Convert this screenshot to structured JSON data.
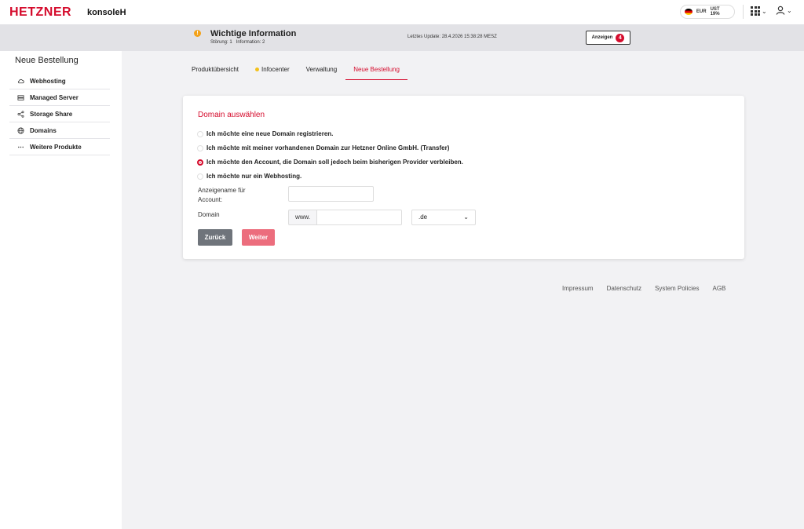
{
  "header": {
    "logo": "HETZNER",
    "product": "konsoleH",
    "currency": "EUR",
    "vat": "UST 19%"
  },
  "infobar": {
    "title": "Wichtige Information",
    "disruptions": "Störung: 1",
    "information": "Information: 2",
    "last_update": "Letztes Update: 28.4.2026 15:38:28 MESZ",
    "show_label": "Anzeigen",
    "badge_count": "4"
  },
  "sidebar": {
    "title": "Neue Bestellung",
    "items": [
      {
        "label": "Webhosting",
        "icon": "cloud-icon"
      },
      {
        "label": "Managed Server",
        "icon": "server-icon"
      },
      {
        "label": "Storage Share",
        "icon": "share-icon"
      },
      {
        "label": "Domains",
        "icon": "globe-icon"
      },
      {
        "label": "Weitere Produkte",
        "icon": "more-icon"
      }
    ]
  },
  "tabs": [
    {
      "label": "Produktübersicht"
    },
    {
      "label": "Infocenter"
    },
    {
      "label": "Verwaltung"
    },
    {
      "label": "Neue Bestellung",
      "active": true
    }
  ],
  "form": {
    "title": "Domain auswählen",
    "options": [
      {
        "label": "Ich möchte eine neue Domain registrieren.",
        "checked": false
      },
      {
        "label": "Ich möchte mit meiner vorhandenen Domain zur Hetzner Online GmbH. (Transfer)",
        "checked": false
      },
      {
        "label": "Ich möchte den Account, die Domain soll jedoch beim bisherigen Provider verbleiben.",
        "checked": true
      },
      {
        "label": "Ich möchte nur ein Webhosting.",
        "checked": false
      }
    ],
    "display_name_label_1": "Anzeigename für",
    "display_name_label_2": "Account:",
    "display_name_value": "",
    "domain_label": "Domain",
    "domain_prefix": "www.",
    "domain_value": "",
    "tld_selected": ".de",
    "back_label": "Zurück",
    "next_label": "Weiter"
  },
  "footer": {
    "links": [
      "Impressum",
      "Datenschutz",
      "System Policies",
      "AGB"
    ]
  },
  "colors": {
    "brand_red": "#d50c2d",
    "warning": "#f3a21a",
    "infocenter_dot": "#f3c11a"
  }
}
